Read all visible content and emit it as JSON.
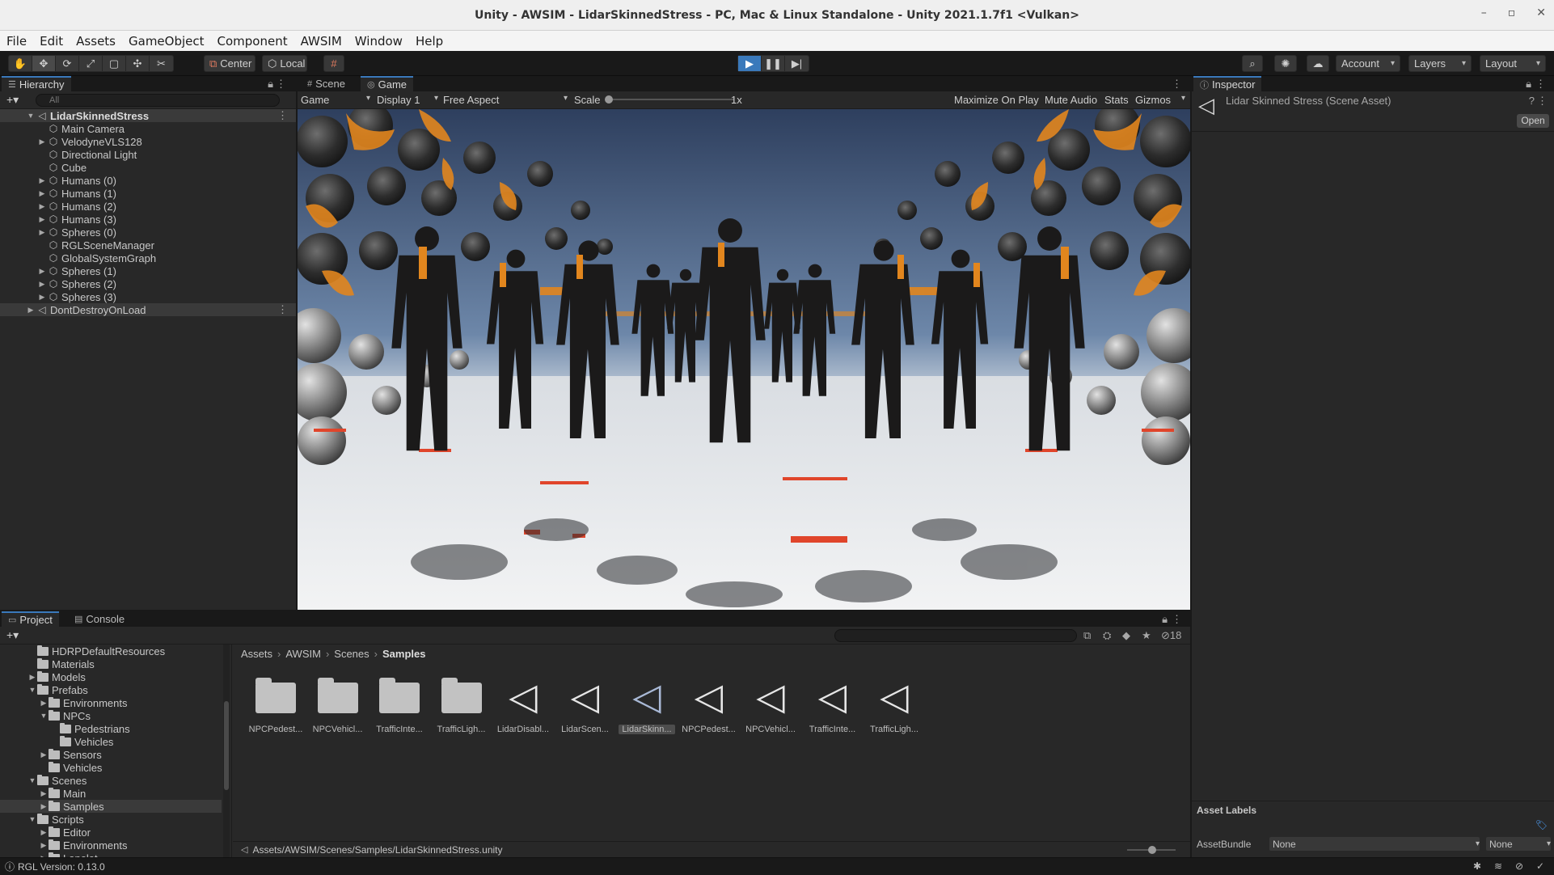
{
  "window": {
    "title": "Unity - AWSIM - LidarSkinnedStress - PC, Mac & Linux Standalone - Unity 2021.1.7f1 <Vulkan>",
    "controls": [
      "–",
      "▫",
      "✕"
    ]
  },
  "menu": [
    "File",
    "Edit",
    "Assets",
    "GameObject",
    "Component",
    "AWSIM",
    "Window",
    "Help"
  ],
  "toolbar": {
    "pivot_label": "Center",
    "space_label": "Local",
    "account_label": "Account",
    "layers_label": "Layers",
    "layout_label": "Layout"
  },
  "hierarchy": {
    "tab_label": "Hierarchy",
    "search_placeholder": "All",
    "root": "LidarSkinnedStress",
    "items": [
      {
        "label": "Main Camera",
        "expandable": false
      },
      {
        "label": "VelodyneVLS128",
        "expandable": true
      },
      {
        "label": "Directional Light",
        "expandable": false
      },
      {
        "label": "Cube",
        "expandable": false
      },
      {
        "label": "Humans (0)",
        "expandable": true
      },
      {
        "label": "Humans (1)",
        "expandable": true
      },
      {
        "label": "Humans (2)",
        "expandable": true
      },
      {
        "label": "Humans (3)",
        "expandable": true
      },
      {
        "label": "Spheres (0)",
        "expandable": true
      },
      {
        "label": "RGLSceneManager",
        "expandable": false
      },
      {
        "label": "GlobalSystemGraph",
        "expandable": false
      },
      {
        "label": "Spheres (1)",
        "expandable": true
      },
      {
        "label": "Spheres (2)",
        "expandable": true
      },
      {
        "label": "Spheres (3)",
        "expandable": true
      }
    ],
    "dont_destroy": "DontDestroyOnLoad"
  },
  "game_view": {
    "scene_tab": "Scene",
    "game_tab": "Game",
    "view_select": "Game",
    "display_select": "Display 1",
    "aspect_select": "Free Aspect",
    "scale_label": "Scale",
    "scale_value": "1x",
    "maximize": "Maximize On Play",
    "mute": "Mute Audio",
    "stats": "Stats",
    "gizmos": "Gizmos"
  },
  "inspector": {
    "tab_label": "Inspector",
    "asset_title": "Lidar Skinned Stress (Scene Asset)",
    "open_button": "Open",
    "asset_labels": "Asset Labels",
    "assetbundle_label": "AssetBundle",
    "assetbundle_value": "None",
    "variant_value": "None"
  },
  "project": {
    "project_tab": "Project",
    "console_tab": "Console",
    "hidden_count": "18",
    "breadcrumb": [
      "Assets",
      "AWSIM",
      "Scenes",
      "Samples"
    ],
    "tree": [
      {
        "label": "HDRPDefaultResources",
        "indent": 1,
        "arrow": "",
        "sel": false
      },
      {
        "label": "Materials",
        "indent": 1,
        "arrow": "",
        "sel": false
      },
      {
        "label": "Models",
        "indent": 1,
        "arrow": "▶",
        "sel": false
      },
      {
        "label": "Prefabs",
        "indent": 1,
        "arrow": "▼",
        "sel": false
      },
      {
        "label": "Environments",
        "indent": 2,
        "arrow": "▶",
        "sel": false
      },
      {
        "label": "NPCs",
        "indent": 2,
        "arrow": "▼",
        "sel": false
      },
      {
        "label": "Pedestrians",
        "indent": 3,
        "arrow": "",
        "sel": false
      },
      {
        "label": "Vehicles",
        "indent": 3,
        "arrow": "",
        "sel": false
      },
      {
        "label": "Sensors",
        "indent": 2,
        "arrow": "▶",
        "sel": false
      },
      {
        "label": "Vehicles",
        "indent": 2,
        "arrow": "",
        "sel": false
      },
      {
        "label": "Scenes",
        "indent": 1,
        "arrow": "▼",
        "sel": false
      },
      {
        "label": "Main",
        "indent": 2,
        "arrow": "▶",
        "sel": false
      },
      {
        "label": "Samples",
        "indent": 2,
        "arrow": "▶",
        "sel": true
      },
      {
        "label": "Scripts",
        "indent": 1,
        "arrow": "▼",
        "sel": false
      },
      {
        "label": "Editor",
        "indent": 2,
        "arrow": "▶",
        "sel": false
      },
      {
        "label": "Environments",
        "indent": 2,
        "arrow": "▶",
        "sel": false
      },
      {
        "label": "Lanelet",
        "indent": 2,
        "arrow": "▶",
        "sel": false
      }
    ],
    "grid": [
      {
        "label": "NPCPedest...",
        "kind": "folder"
      },
      {
        "label": "NPCVehicl...",
        "kind": "folder"
      },
      {
        "label": "TrafficInte...",
        "kind": "folder"
      },
      {
        "label": "TrafficLigh...",
        "kind": "folder"
      },
      {
        "label": "LidarDisabl...",
        "kind": "scene"
      },
      {
        "label": "LidarScen...",
        "kind": "scene"
      },
      {
        "label": "LidarSkinn...",
        "kind": "scene-selected"
      },
      {
        "label": "NPCPedest...",
        "kind": "scene"
      },
      {
        "label": "NPCVehicl...",
        "kind": "scene"
      },
      {
        "label": "TrafficInte...",
        "kind": "scene"
      },
      {
        "label": "TrafficLigh...",
        "kind": "scene"
      }
    ],
    "path": "Assets/AWSIM/Scenes/Samples/LidarSkinnedStress.unity"
  },
  "status": {
    "text": "RGL Version: 0.13.0"
  }
}
